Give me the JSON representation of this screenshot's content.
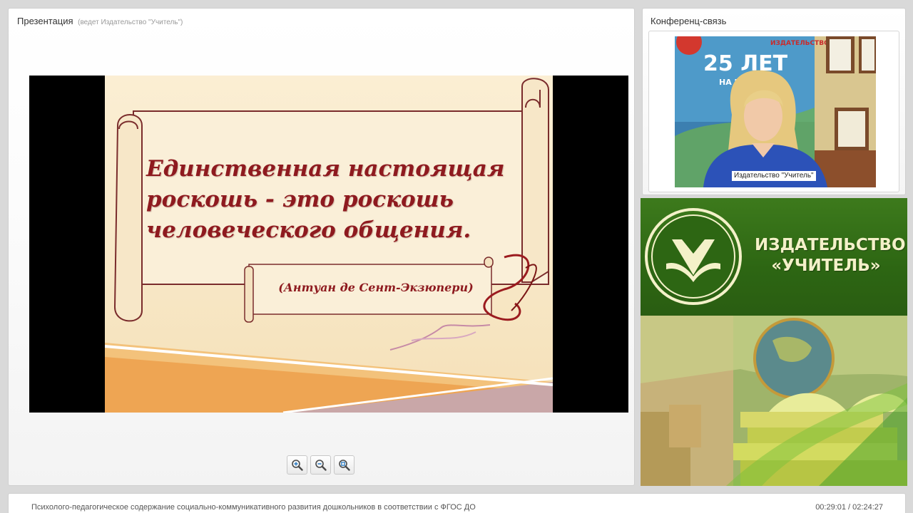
{
  "presentation": {
    "title": "Презентация",
    "host": "(ведет Издательство \"Учитель\")",
    "slide": {
      "quote": "Единственная настоящая\nроскошь - это роскошь\nчеловеческого общения.",
      "author": "(Антуан де Сент-Экзюпери)"
    },
    "zoom": {
      "zoom_in_icon": "magnifier-plus-icon",
      "zoom_out_icon": "magnifier-minus-icon",
      "zoom_fit_icon": "magnifier-fit-icon"
    }
  },
  "conference": {
    "title": "Конференц-связь",
    "participant_label": "Издательство \"Учитель\"",
    "background_poster_text": "25 ЛЕТ",
    "background_poster_subtext": "НА КНИЖНОМ",
    "background_poster_top": "ИЗДАТЕЛЬСТВО"
  },
  "banner": {
    "publisher_name": "ИЗДАТЕЛЬСТВО\n«УЧИТЕЛЬ»",
    "logo_icon": "book-logo-icon"
  },
  "footer": {
    "webinar_title": "Психолого-педагогическое содержание социально-коммуникативного развития дошкольников в соответствии с ФГОС ДО",
    "time": "00:29:01 / 02:24:27"
  },
  "colors": {
    "quote": "#8e1a1f",
    "banner_green": "#2d6613",
    "banner_text": "#f4f1c9",
    "slide_bg": "#fbeed3"
  }
}
